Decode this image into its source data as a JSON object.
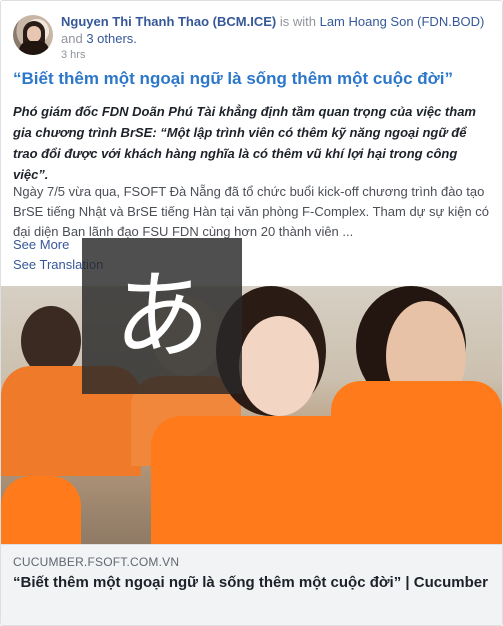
{
  "post": {
    "author": "Nguyen Thi Thanh Thao (BCM.ICE)",
    "is_with": "is with",
    "tagged_person": "Lam Hoang Son (FDN.BOD)",
    "and": "and",
    "others": "3 others.",
    "time": "3 hrs",
    "title": "“Biết thêm một ngoại ngữ là sống thêm một cuộc đời”",
    "italic_text": "Phó giám đốc FDN Doãn Phú Tài khẳng định tầm quan trọng của việc tham gia chương trình BrSE: “Một lập trình viên có thêm kỹ năng ngoại ngữ để trao đổi được với khách hàng nghĩa là có thêm vũ khí lợi hại trong công việc”.",
    "paragraph": "Ngày 7/5 vừa qua, FSOFT Đà Nẵng đã tổ chức buổi kick-off chương trình đào tạo BrSE tiếng Nhật và BrSE tiếng Hàn tại văn phòng F-Complex. Tham dự sự kiện có đại diện Ban lãnh đạo FSU FDN cùng hơn 20 thành viên ...",
    "see_more": "See More",
    "see_translation": "See Translation"
  },
  "ime_overlay": {
    "glyph": "あ"
  },
  "link_preview": {
    "domain": "CUCUMBER.FSOFT.COM.VN",
    "title": "“Biết thêm một ngoại ngữ là sống thêm một cuộc đời” | Cucumber"
  },
  "colors": {
    "link": "#365899",
    "title_blue": "#2d77c9",
    "shirt_orange": "#ff7a1a"
  }
}
